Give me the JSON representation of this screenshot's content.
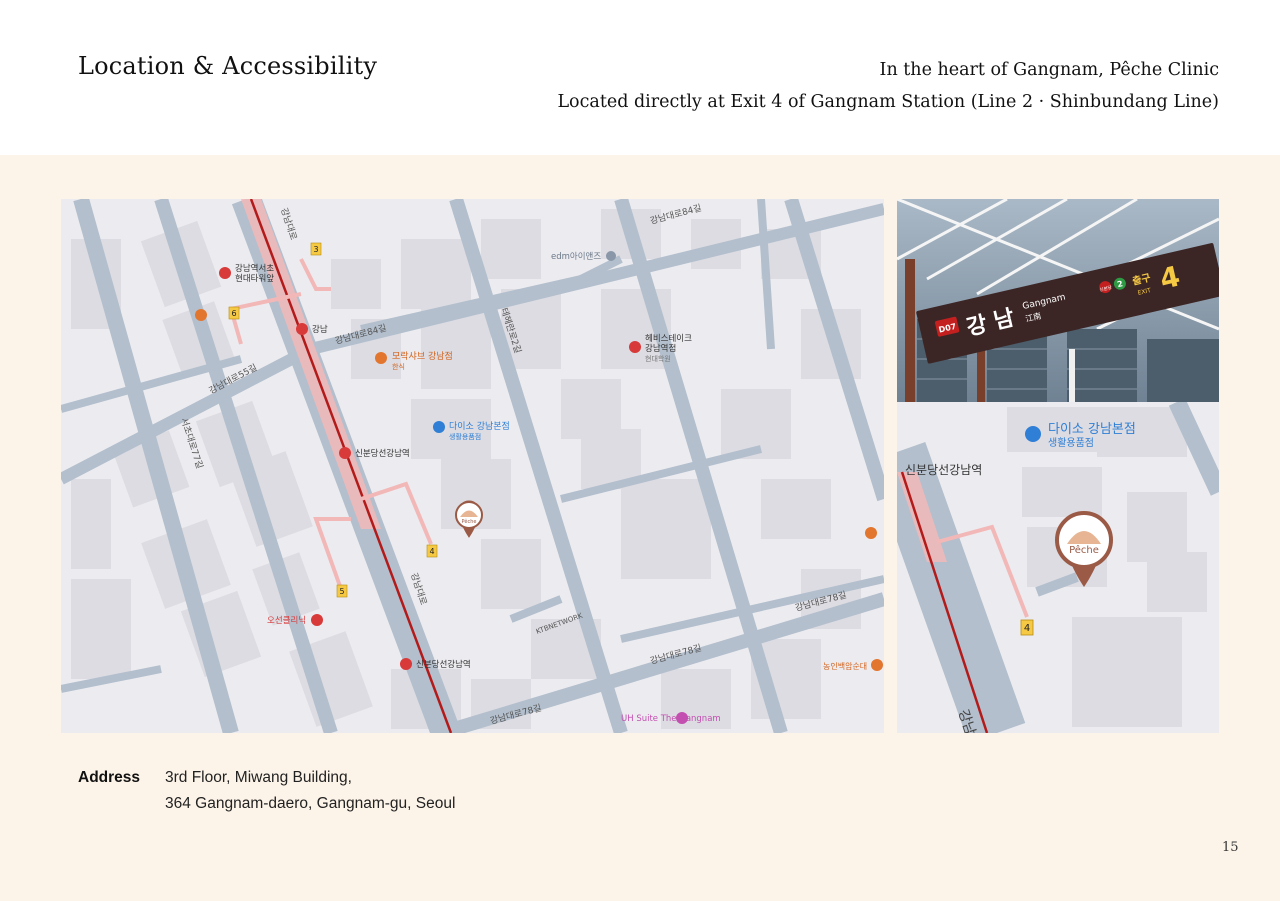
{
  "header": {
    "title": "Location & Accessibility",
    "subtitle_line1": "In the heart of Gangnam, Pêche Clinic",
    "subtitle_line2": "Located directly at Exit 4 of Gangnam Station (Line 2 · Shinbundang Line)"
  },
  "map": {
    "labels": {
      "edm": "edm아이앤즈",
      "daiso": "다이소 강남본점",
      "daiso_sub": "생활용품점",
      "daiso_zoom": "다이소 강남본점",
      "daiso_zoom_sub": "생활용품점",
      "peche": "Pêche",
      "peche_zoom": "Pêche",
      "uh_suite": "UH Suite The Gangnam",
      "ohsun": "오선클리닉",
      "shinbundang_station": "신분당선강남역",
      "shinbundang_station2": "신분당선강남역",
      "shinbundang_zoom": "신분당선강남역",
      "gangnam_station": "강남",
      "gangnam_seocho": "강남역서초",
      "gangnam_seocho2": "현대타워앞",
      "morak": "모락샤브 강남점",
      "morak_sub": "한식",
      "heves": "헤비스테이크",
      "heves2": "강남역점",
      "heves3": "현대학원",
      "nongin": "농인백암순대",
      "road_daero84": "강남대로84길",
      "road_daero84b": "강남대로84길",
      "road_daero78": "강남대로78길",
      "road_daero78b": "강남대로78길",
      "road_daero78c": "강남대로78길",
      "road_daero55": "강남대로55길",
      "road_gangnamdaero": "강남대로",
      "road_gangnamdaero2": "강남대로",
      "road_gangnamdaero_zoom": "강남대로",
      "road_teheran": "테헤란로2길",
      "road_seocho": "서초대로77길",
      "ktb": "KTBNETWORK",
      "exits": [
        "3",
        "6",
        "4",
        "5"
      ],
      "exit_zoom": "4"
    }
  },
  "photo": {
    "station_code": "D07",
    "station_kr": "강 남",
    "station_en": "Gangnam",
    "station_hanja": "江南",
    "exit_kr": "출구",
    "exit_en": "EXIT",
    "exit_num": "4",
    "line_num": "2",
    "line_tag": "신분당"
  },
  "address": {
    "label": "Address",
    "line1": "3rd Floor, Miwang Building,",
    "line2": "364 Gangnam-daero, Gangnam-gu, Seoul"
  },
  "page_number": "15",
  "colors": {
    "panel_bg": "#fdf4e9",
    "road": "#b3bfcd",
    "block": "#dcdce2",
    "subway_highlight": "#f2b8b8",
    "subway_line": "#b31b1b",
    "peche_marker": "#9a5a46",
    "exit_badge": "#f6c945",
    "daiso_blue": "#2f7fd6",
    "restaurant_orange": "#e3762e"
  }
}
